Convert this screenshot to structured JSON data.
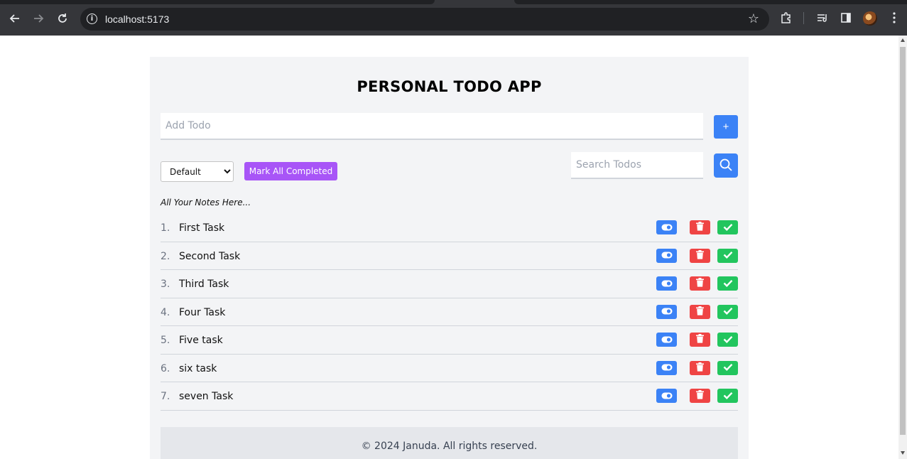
{
  "browser": {
    "url": "localhost:5173",
    "icons": [
      "back-icon",
      "forward-icon",
      "reload-icon",
      "info-icon",
      "star-icon",
      "extensions-icon",
      "media-icon",
      "side-panel-icon",
      "avatar",
      "menu-icon"
    ]
  },
  "app": {
    "title": "PERSONAL TODO APP",
    "add_placeholder": "Add Todo",
    "add_label": "+",
    "filter": {
      "selected": "Default",
      "options": [
        "Default"
      ]
    },
    "mark_all_label": "Mark All Completed",
    "search_placeholder": "Search Todos",
    "notes_label": "All Your Notes Here...",
    "todos": [
      {
        "num": "1.",
        "text": "First Task"
      },
      {
        "num": "2.",
        "text": "Second Task"
      },
      {
        "num": "3.",
        "text": "Third Task"
      },
      {
        "num": "4.",
        "text": "Four Task"
      },
      {
        "num": "5.",
        "text": "Five task"
      },
      {
        "num": "6.",
        "text": "six task"
      },
      {
        "num": "7.",
        "text": "seven Task"
      }
    ],
    "footer": "© 2024 Januda. All rights reserved."
  },
  "colors": {
    "primary": "#3b82f6",
    "purple": "#a855f7",
    "danger": "#ef4444",
    "success": "#22c55e",
    "card_bg": "#f3f4f6"
  }
}
